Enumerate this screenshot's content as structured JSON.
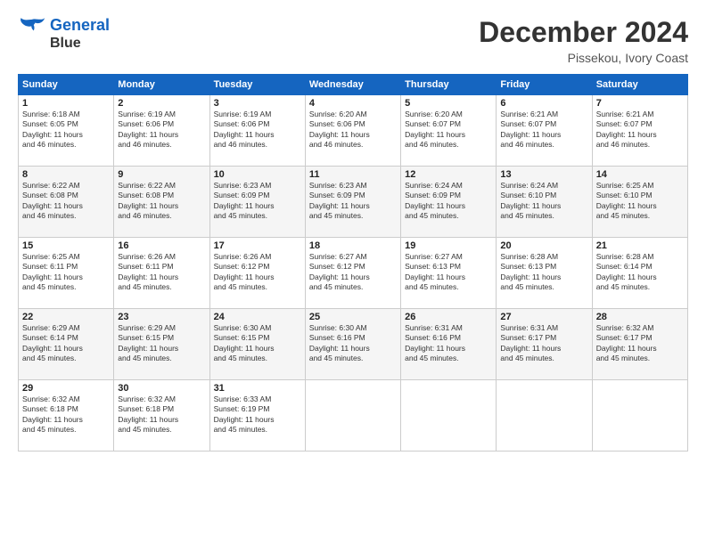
{
  "logo": {
    "line1": "General",
    "line2": "Blue"
  },
  "header": {
    "title": "December 2024",
    "location": "Pissekou, Ivory Coast"
  },
  "weekdays": [
    "Sunday",
    "Monday",
    "Tuesday",
    "Wednesday",
    "Thursday",
    "Friday",
    "Saturday"
  ],
  "rows": [
    [
      {
        "day": "1",
        "info": "Sunrise: 6:18 AM\nSunset: 6:05 PM\nDaylight: 11 hours\nand 46 minutes."
      },
      {
        "day": "2",
        "info": "Sunrise: 6:19 AM\nSunset: 6:06 PM\nDaylight: 11 hours\nand 46 minutes."
      },
      {
        "day": "3",
        "info": "Sunrise: 6:19 AM\nSunset: 6:06 PM\nDaylight: 11 hours\nand 46 minutes."
      },
      {
        "day": "4",
        "info": "Sunrise: 6:20 AM\nSunset: 6:06 PM\nDaylight: 11 hours\nand 46 minutes."
      },
      {
        "day": "5",
        "info": "Sunrise: 6:20 AM\nSunset: 6:07 PM\nDaylight: 11 hours\nand 46 minutes."
      },
      {
        "day": "6",
        "info": "Sunrise: 6:21 AM\nSunset: 6:07 PM\nDaylight: 11 hours\nand 46 minutes."
      },
      {
        "day": "7",
        "info": "Sunrise: 6:21 AM\nSunset: 6:07 PM\nDaylight: 11 hours\nand 46 minutes."
      }
    ],
    [
      {
        "day": "8",
        "info": "Sunrise: 6:22 AM\nSunset: 6:08 PM\nDaylight: 11 hours\nand 46 minutes."
      },
      {
        "day": "9",
        "info": "Sunrise: 6:22 AM\nSunset: 6:08 PM\nDaylight: 11 hours\nand 46 minutes."
      },
      {
        "day": "10",
        "info": "Sunrise: 6:23 AM\nSunset: 6:09 PM\nDaylight: 11 hours\nand 45 minutes."
      },
      {
        "day": "11",
        "info": "Sunrise: 6:23 AM\nSunset: 6:09 PM\nDaylight: 11 hours\nand 45 minutes."
      },
      {
        "day": "12",
        "info": "Sunrise: 6:24 AM\nSunset: 6:09 PM\nDaylight: 11 hours\nand 45 minutes."
      },
      {
        "day": "13",
        "info": "Sunrise: 6:24 AM\nSunset: 6:10 PM\nDaylight: 11 hours\nand 45 minutes."
      },
      {
        "day": "14",
        "info": "Sunrise: 6:25 AM\nSunset: 6:10 PM\nDaylight: 11 hours\nand 45 minutes."
      }
    ],
    [
      {
        "day": "15",
        "info": "Sunrise: 6:25 AM\nSunset: 6:11 PM\nDaylight: 11 hours\nand 45 minutes."
      },
      {
        "day": "16",
        "info": "Sunrise: 6:26 AM\nSunset: 6:11 PM\nDaylight: 11 hours\nand 45 minutes."
      },
      {
        "day": "17",
        "info": "Sunrise: 6:26 AM\nSunset: 6:12 PM\nDaylight: 11 hours\nand 45 minutes."
      },
      {
        "day": "18",
        "info": "Sunrise: 6:27 AM\nSunset: 6:12 PM\nDaylight: 11 hours\nand 45 minutes."
      },
      {
        "day": "19",
        "info": "Sunrise: 6:27 AM\nSunset: 6:13 PM\nDaylight: 11 hours\nand 45 minutes."
      },
      {
        "day": "20",
        "info": "Sunrise: 6:28 AM\nSunset: 6:13 PM\nDaylight: 11 hours\nand 45 minutes."
      },
      {
        "day": "21",
        "info": "Sunrise: 6:28 AM\nSunset: 6:14 PM\nDaylight: 11 hours\nand 45 minutes."
      }
    ],
    [
      {
        "day": "22",
        "info": "Sunrise: 6:29 AM\nSunset: 6:14 PM\nDaylight: 11 hours\nand 45 minutes."
      },
      {
        "day": "23",
        "info": "Sunrise: 6:29 AM\nSunset: 6:15 PM\nDaylight: 11 hours\nand 45 minutes."
      },
      {
        "day": "24",
        "info": "Sunrise: 6:30 AM\nSunset: 6:15 PM\nDaylight: 11 hours\nand 45 minutes."
      },
      {
        "day": "25",
        "info": "Sunrise: 6:30 AM\nSunset: 6:16 PM\nDaylight: 11 hours\nand 45 minutes."
      },
      {
        "day": "26",
        "info": "Sunrise: 6:31 AM\nSunset: 6:16 PM\nDaylight: 11 hours\nand 45 minutes."
      },
      {
        "day": "27",
        "info": "Sunrise: 6:31 AM\nSunset: 6:17 PM\nDaylight: 11 hours\nand 45 minutes."
      },
      {
        "day": "28",
        "info": "Sunrise: 6:32 AM\nSunset: 6:17 PM\nDaylight: 11 hours\nand 45 minutes."
      }
    ],
    [
      {
        "day": "29",
        "info": "Sunrise: 6:32 AM\nSunset: 6:18 PM\nDaylight: 11 hours\nand 45 minutes."
      },
      {
        "day": "30",
        "info": "Sunrise: 6:32 AM\nSunset: 6:18 PM\nDaylight: 11 hours\nand 45 minutes."
      },
      {
        "day": "31",
        "info": "Sunrise: 6:33 AM\nSunset: 6:19 PM\nDaylight: 11 hours\nand 45 minutes."
      },
      null,
      null,
      null,
      null
    ]
  ]
}
